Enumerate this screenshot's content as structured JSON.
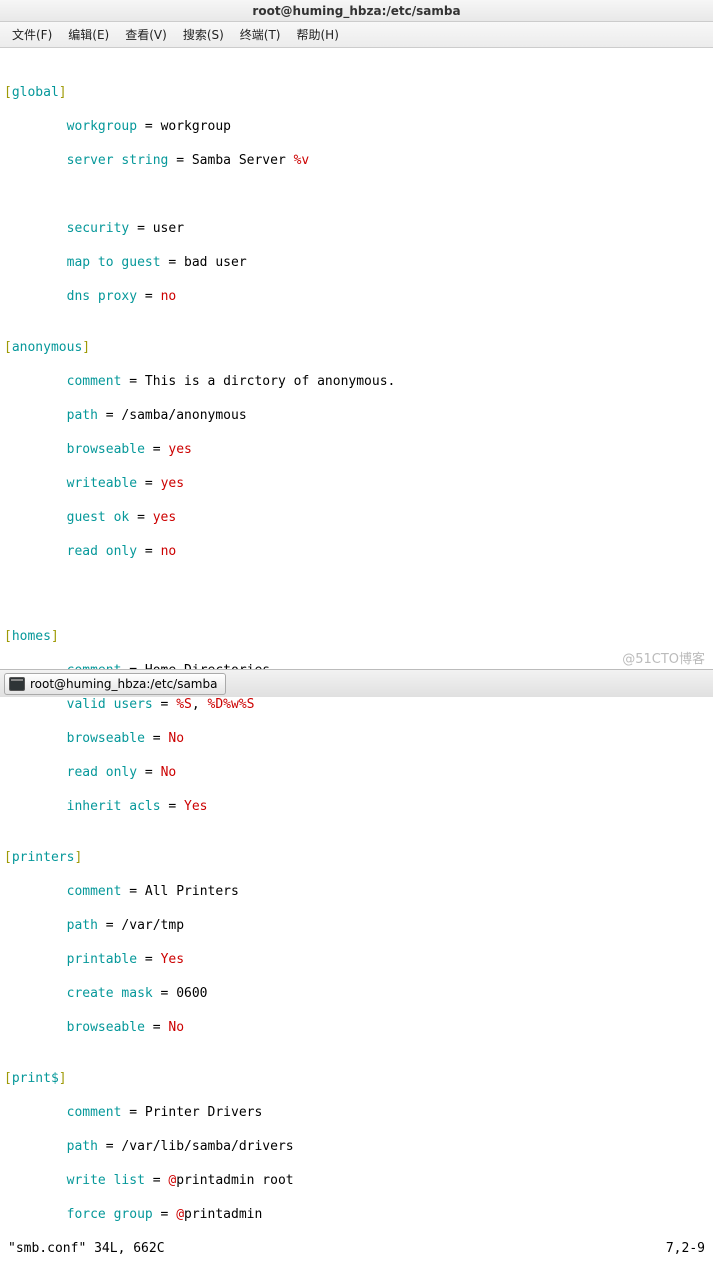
{
  "window": {
    "title": "root@huming_hbza:/etc/samba"
  },
  "menu": {
    "file": "文件(F)",
    "edit": "编辑(E)",
    "view": "查看(V)",
    "search": "搜索(S)",
    "terminal": "终端(T)",
    "help": "帮助(H)"
  },
  "conf": {
    "sections": {
      "global": {
        "header_open": "[",
        "header_name": "global",
        "header_close": "]",
        "workgroup": {
          "key": "workgroup",
          "val": "workgroup"
        },
        "server_string": {
          "key": "server string",
          "val_pre": "Samba Server ",
          "val_tok": "%v"
        },
        "security": {
          "key": "security",
          "val": "user"
        },
        "map_to_guest": {
          "key": "map to guest",
          "val": "bad user"
        },
        "dns_proxy": {
          "key": "dns proxy",
          "val": "no"
        }
      },
      "anonymous": {
        "header_open": "[",
        "header_name": "anonymous",
        "header_close": "]",
        "comment": {
          "key": "comment",
          "val": "This is a dirctory of anonymous."
        },
        "path": {
          "key": "path",
          "val": "/samba/anonymous"
        },
        "browseable": {
          "key": "browseable",
          "val": "yes"
        },
        "writeable": {
          "key": "writeable",
          "val": "yes"
        },
        "guest_ok": {
          "key": "guest ok",
          "val": "yes"
        },
        "read_only": {
          "key": "read only",
          "val": "no"
        }
      },
      "homes": {
        "header_open": "[",
        "header_name": "homes",
        "header_close": "]",
        "comment": {
          "key": "comment",
          "val": "Home Directories"
        },
        "valid_users": {
          "key": "valid users",
          "t1": "%S",
          "sep": ", ",
          "t2a": "%D%w",
          "t2b": "%S"
        },
        "browseable": {
          "key": "browseable",
          "val": "No"
        },
        "read_only": {
          "key": "read only",
          "val": "No"
        },
        "inherit_acls": {
          "key": "inherit acls",
          "val": "Yes"
        }
      },
      "printers": {
        "header_open": "[",
        "header_name": "printers",
        "header_close": "]",
        "comment": {
          "key": "comment",
          "val": "All Printers"
        },
        "path": {
          "key": "path",
          "val": "/var/tmp"
        },
        "printable": {
          "key": "printable",
          "val": "Yes"
        },
        "create_mask": {
          "key": "create mask",
          "val": "0600"
        },
        "browseable": {
          "key": "browseable",
          "val": "No"
        }
      },
      "printdollar": {
        "header_open": "[",
        "header_name": "print$",
        "header_close": "]",
        "comment": {
          "key": "comment",
          "val": "Printer Drivers"
        },
        "path": {
          "key": "path",
          "val": "/var/lib/samba/drivers"
        },
        "write_list": {
          "key": "write list",
          "at": "@",
          "val": "printadmin root"
        },
        "force_group": {
          "key": "force group",
          "at": "@",
          "val": "printadmin"
        }
      }
    },
    "eq": " = "
  },
  "status": {
    "left": "\"smb.conf\" 34L, 662C",
    "right": "7,2-9"
  },
  "taskbar": {
    "label": "root@huming_hbza:/etc/samba"
  },
  "watermark": "@51CTO博客"
}
